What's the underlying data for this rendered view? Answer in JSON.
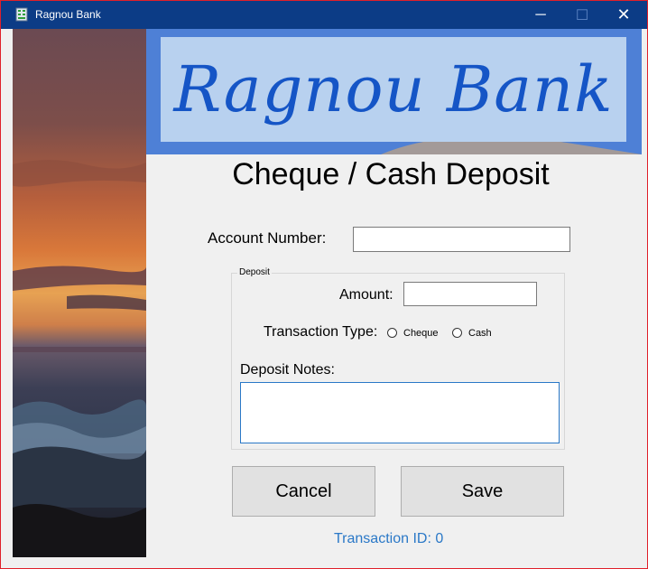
{
  "window": {
    "title": "Ragnou Bank",
    "minimize_glyph": "─",
    "maximize_glyph": "☐",
    "close_glyph": "✕"
  },
  "banner": {
    "text": "Ragnou Bank"
  },
  "form": {
    "heading": "Cheque / Cash Deposit",
    "account_number_label": "Account Number:",
    "account_number_value": "",
    "deposit_group_title": "Deposit",
    "amount_label": "Amount:",
    "amount_value": "",
    "transaction_type_label": "Transaction Type:",
    "radio_cheque_label": "Cheque",
    "radio_cash_label": "Cash",
    "deposit_notes_label": "Deposit Notes:",
    "deposit_notes_value": "",
    "cancel_label": "Cancel",
    "save_label": "Save",
    "transaction_id_label": "Transaction ID:",
    "transaction_id_value": "0"
  },
  "icons": {
    "app": "bank-app-icon"
  },
  "colors": {
    "titlebar": "#0c3c86",
    "banner_text": "#1555c6",
    "link_text": "#2a78c7",
    "window_border": "#e0202a"
  }
}
